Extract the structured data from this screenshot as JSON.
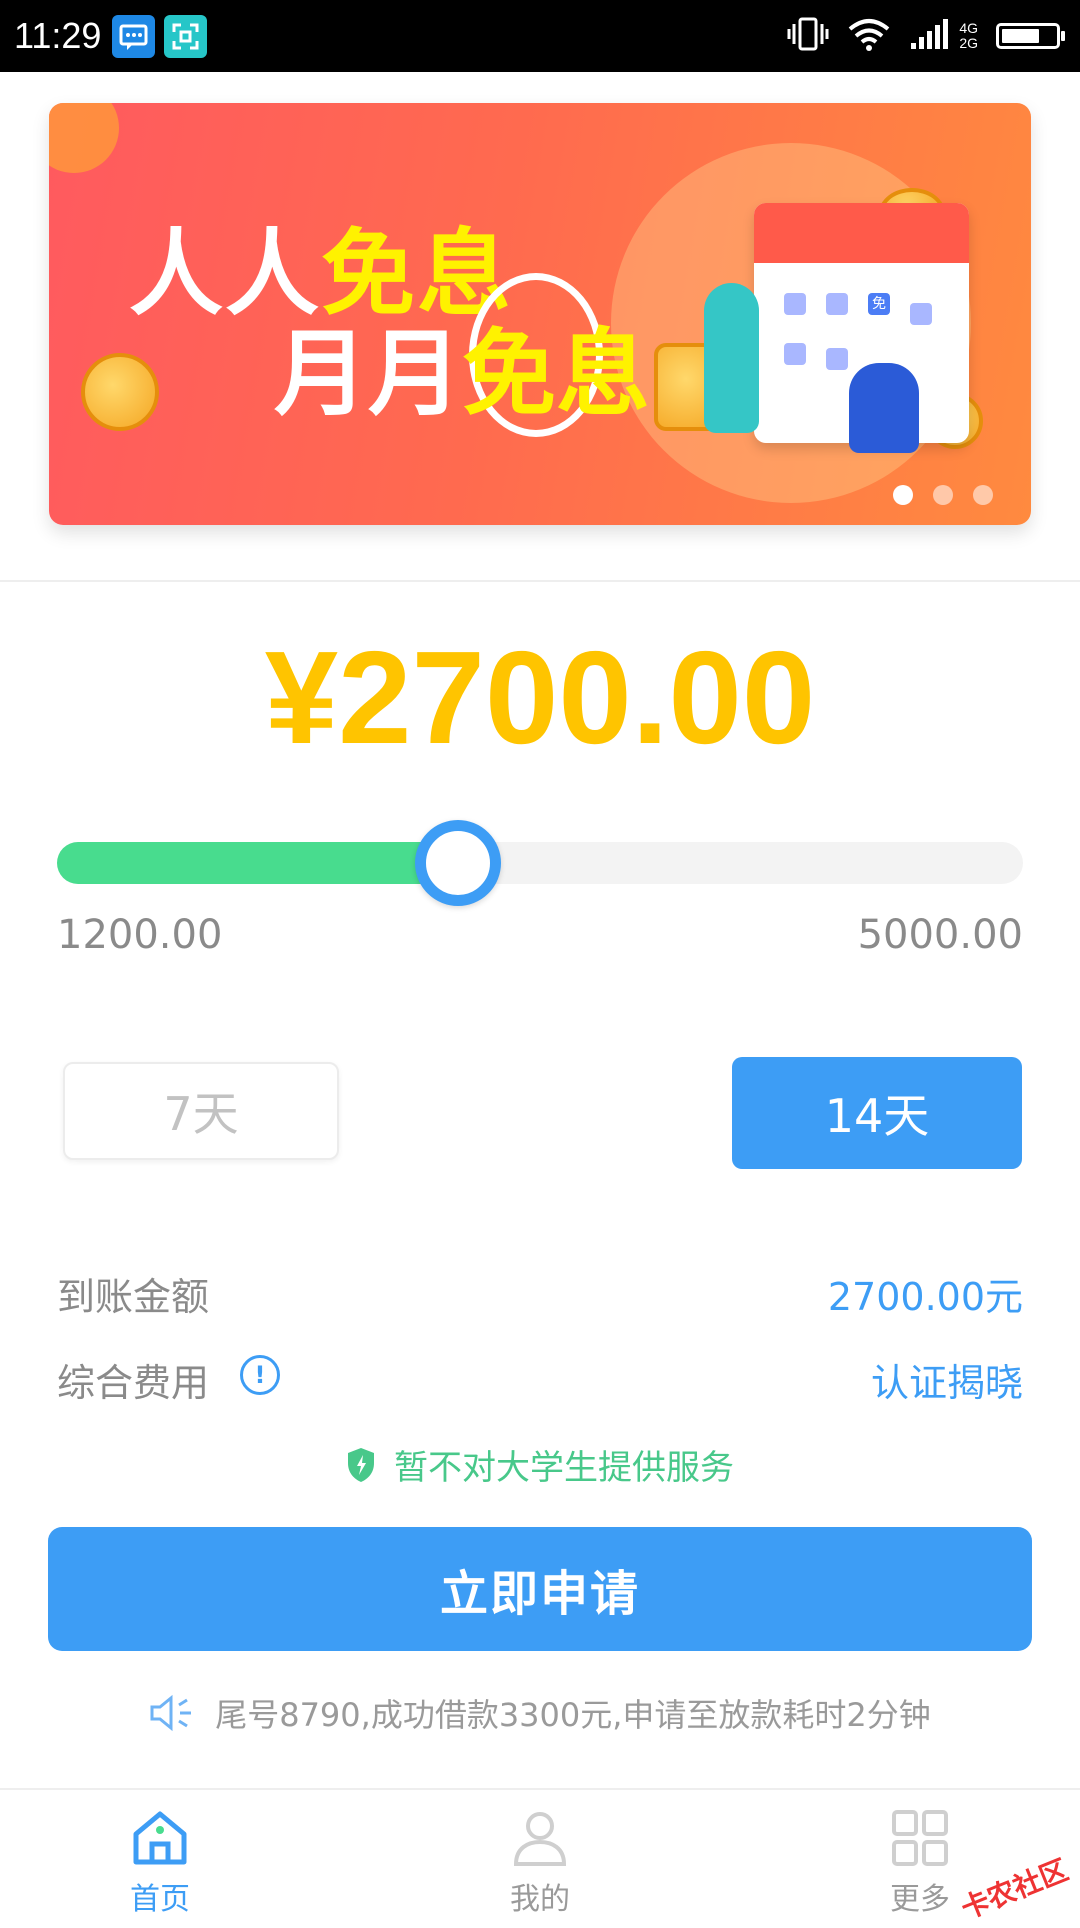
{
  "status_bar": {
    "time": "11:29",
    "network": "4G\n2G",
    "battery_level": 0.72,
    "icons": [
      "message-icon",
      "scan-icon",
      "vibrate-icon",
      "wifi-icon",
      "signal-icon",
      "battery-icon"
    ]
  },
  "banner": {
    "line1_plain": "人人",
    "line1_highlight": "免息",
    "line2_plain": "月月",
    "line2_highlight": "免息",
    "badge": "免",
    "slide_count": 3,
    "active_slide": 0
  },
  "loan": {
    "amount": "¥2700.00",
    "slider_min": "1200.00",
    "slider_max": "5000.00",
    "slider_value": 2700,
    "slider_min_value": 1200,
    "slider_max_value": 5000
  },
  "terms": {
    "option_7": "7天",
    "option_14": "14天",
    "selected": "14天"
  },
  "info": {
    "arrival_label": "到账金额",
    "arrival_value": "2700.00元",
    "fee_label": "综合费用",
    "fee_info": "!",
    "fee_value": "认证揭晓"
  },
  "notice": "暂不对大学生提供服务",
  "apply_button": "立即申请",
  "ticker": "尾号8790,成功借款3300元,申请至放款耗时2分钟",
  "bottom_nav": {
    "home": "首页",
    "mine": "我的",
    "more": "更多"
  },
  "watermark": "卡农社区",
  "colors": {
    "primary": "#3d9df5",
    "amount": "#ffc400",
    "slider_fill": "#48dc8e",
    "notice": "#48c88a"
  }
}
